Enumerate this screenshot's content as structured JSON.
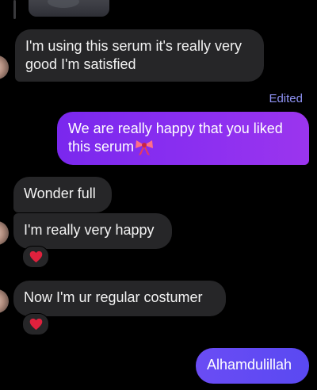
{
  "conversation": {
    "edited_label": "Edited",
    "messages": [
      {
        "direction": "incoming",
        "lines": [
          "I'm using this serum it's really very",
          "good I'm satisfied"
        ]
      },
      {
        "direction": "outgoing",
        "lines": [
          "We are really happy that you liked",
          "this serum"
        ],
        "emoji": "ribbon-icon"
      },
      {
        "direction": "incoming",
        "text": "Wonder full"
      },
      {
        "direction": "incoming",
        "text": "I'm really very happy",
        "reaction": "red-heart-icon"
      },
      {
        "direction": "incoming",
        "text": "Now I'm ur regular costumer",
        "reaction": "red-heart-icon"
      },
      {
        "direction": "outgoing",
        "text": "Alhamdulillah"
      }
    ]
  },
  "colors": {
    "background": "#000000",
    "incoming_bubble": "#262628",
    "outgoing_bubble_gradient": [
      "#7a28ee",
      "#9b35ee"
    ],
    "last_outgoing_bubble": "#5a49f2",
    "edited_label": "#8f93f5",
    "heart": "#e0213d"
  }
}
